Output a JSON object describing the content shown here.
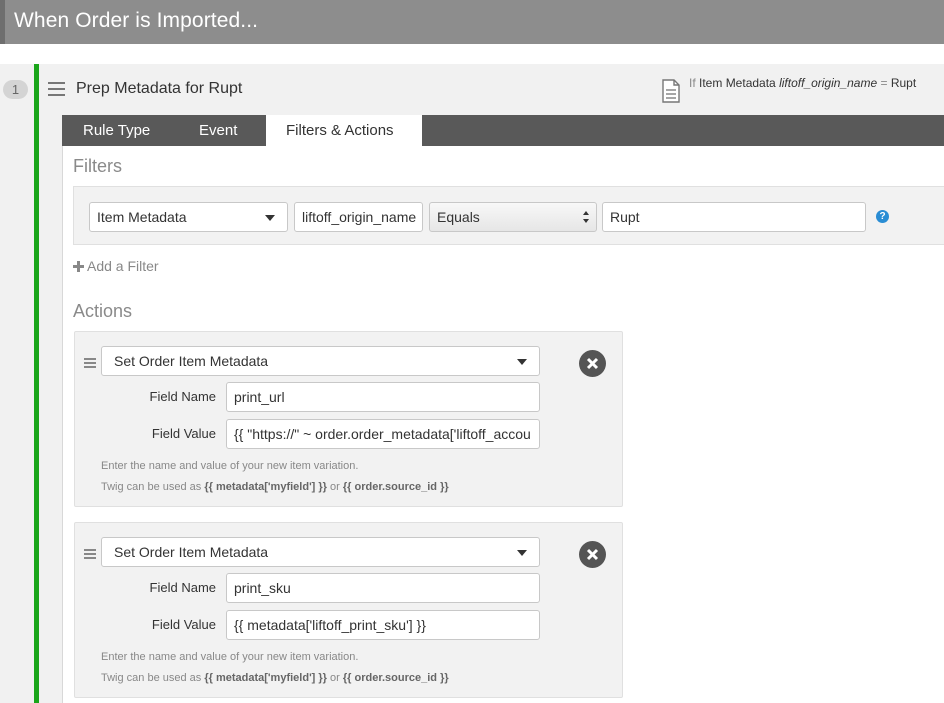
{
  "header": {
    "title": "When Order is Imported..."
  },
  "rule": {
    "number": "1",
    "name": "Prep Metadata for Rupt",
    "summary": {
      "prefix": "If",
      "field": "Item Metadata",
      "key": "liftoff_origin_name",
      "op": "=",
      "value": "Rupt"
    }
  },
  "tabs": [
    {
      "label": "Rule Type"
    },
    {
      "label": "Event"
    },
    {
      "label": "Filters & Actions"
    }
  ],
  "filters": {
    "title": "Filters",
    "row": {
      "field": "Item Metadata",
      "key": "liftoff_origin_name",
      "operator": "Equals",
      "value": "Rupt"
    },
    "help": "?",
    "add_label": "Add a Filter"
  },
  "actions": {
    "title": "Actions",
    "items": [
      {
        "type": "Set Order Item Metadata",
        "field_name_label": "Field Name",
        "field_name": "print_url",
        "field_value_label": "Field Value",
        "field_value": "{{ \"https://\" ~ order.order_metadata['liftoff_accou",
        "help_line1": "Enter the name and value of your new item variation.",
        "help_prefix": "Twig can be used as",
        "help_code1": "{{ metadata['myfield'] }}",
        "help_or": "or",
        "help_code2": "{{ order.source_id }}"
      },
      {
        "type": "Set Order Item Metadata",
        "field_name_label": "Field Name",
        "field_name": "print_sku",
        "field_value_label": "Field Value",
        "field_value": "{{ metadata['liftoff_print_sku'] }}",
        "help_line1": "Enter the name and value of your new item variation.",
        "help_prefix": "Twig can be used as",
        "help_code1": "{{ metadata['myfield'] }}",
        "help_or": "or",
        "help_code2": "{{ order.source_id }}"
      }
    ]
  },
  "colors": {
    "accent": "#1aa61a",
    "header": "#8d8d8d",
    "tabbar": "#595959",
    "help": "#2a8dd4"
  },
  "icons": [
    "hamburger-icon",
    "document-icon",
    "chevron-down-icon",
    "updown-icon",
    "question-icon",
    "plus-icon",
    "drag-handle-icon",
    "close-icon"
  ]
}
